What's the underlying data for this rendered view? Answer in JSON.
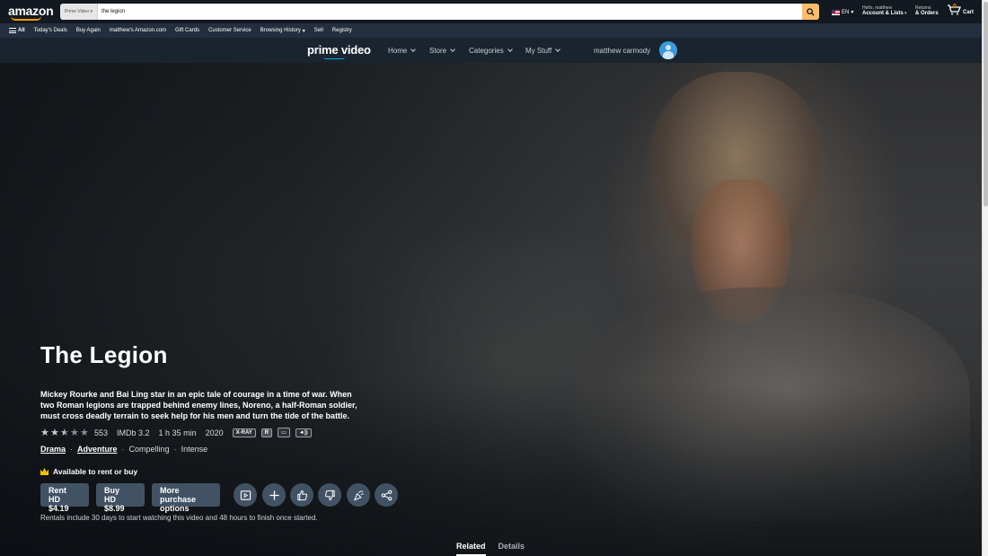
{
  "amazon_nav": {
    "logo": "amazon",
    "search": {
      "category": "Prime Video",
      "query": "the legion"
    },
    "language": "EN",
    "account": {
      "greeting": "Hello, matthew",
      "label": "Account & Lists"
    },
    "orders": {
      "top": "Returns",
      "label": "& Orders"
    },
    "cart": {
      "count": "0",
      "label": "Cart"
    }
  },
  "sub_nav": {
    "all_label": "All",
    "items": [
      "Today's Deals",
      "Buy Again",
      "matthew's Amazon.com",
      "Gift Cards",
      "Customer Service",
      "Browsing History",
      "Sell",
      "Registry"
    ]
  },
  "pv_nav": {
    "logo": "prime video",
    "menus": [
      "Home",
      "Store",
      "Categories",
      "My Stuff"
    ],
    "user": "matthew carmody"
  },
  "title": {
    "name": "The Legion",
    "synopsis": "Mickey Rourke and Bai Ling star in an epic tale of courage in a time of war. When two Roman legions are trapped behind enemy lines, Noreno, a half-Roman soldier, must cross deadly terrain to seek help for his men and turn the tide of the battle.",
    "rating_count": "553",
    "star_rating": 2.5,
    "imdb": "IMDb 3.2",
    "runtime": "1 h 35 min",
    "year": "2020",
    "badges": [
      "X-RAY",
      "R"
    ],
    "genres": [
      "Drama",
      "Adventure"
    ],
    "moods": [
      "Compelling",
      "Intense"
    ],
    "availability": "Available to rent or buy",
    "rent": {
      "line1": "Rent",
      "line2": "HD $4.19"
    },
    "buy": {
      "line1": "Buy",
      "line2": "HD $8.99"
    },
    "more": {
      "line1": "More purchase",
      "line2": "options"
    },
    "rental_note": "Rentals include 30 days to start watching this video and 48 hours to finish once started."
  },
  "tabs": [
    {
      "label": "Related",
      "active": true
    },
    {
      "label": "Details",
      "active": false
    }
  ],
  "colors": {
    "button_bg": "#425265",
    "nav_bg": "#131921",
    "search_btn": "#febd69",
    "prime_accent": "#00a8e1"
  }
}
